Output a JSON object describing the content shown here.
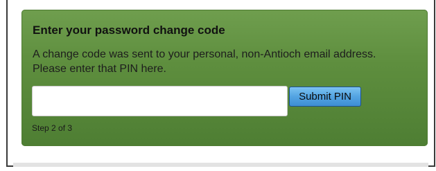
{
  "panel": {
    "title": "Enter your password change code",
    "description": "A change code was sent to your personal, non-Antioch email address. Please enter that PIN here.",
    "pin_input": {
      "value": "",
      "placeholder": ""
    },
    "submit_label": "Submit PIN",
    "step_text": "Step 2 of 3"
  },
  "colors": {
    "panel_green": "#5e8e3e",
    "button_blue": "#53a4e2"
  }
}
